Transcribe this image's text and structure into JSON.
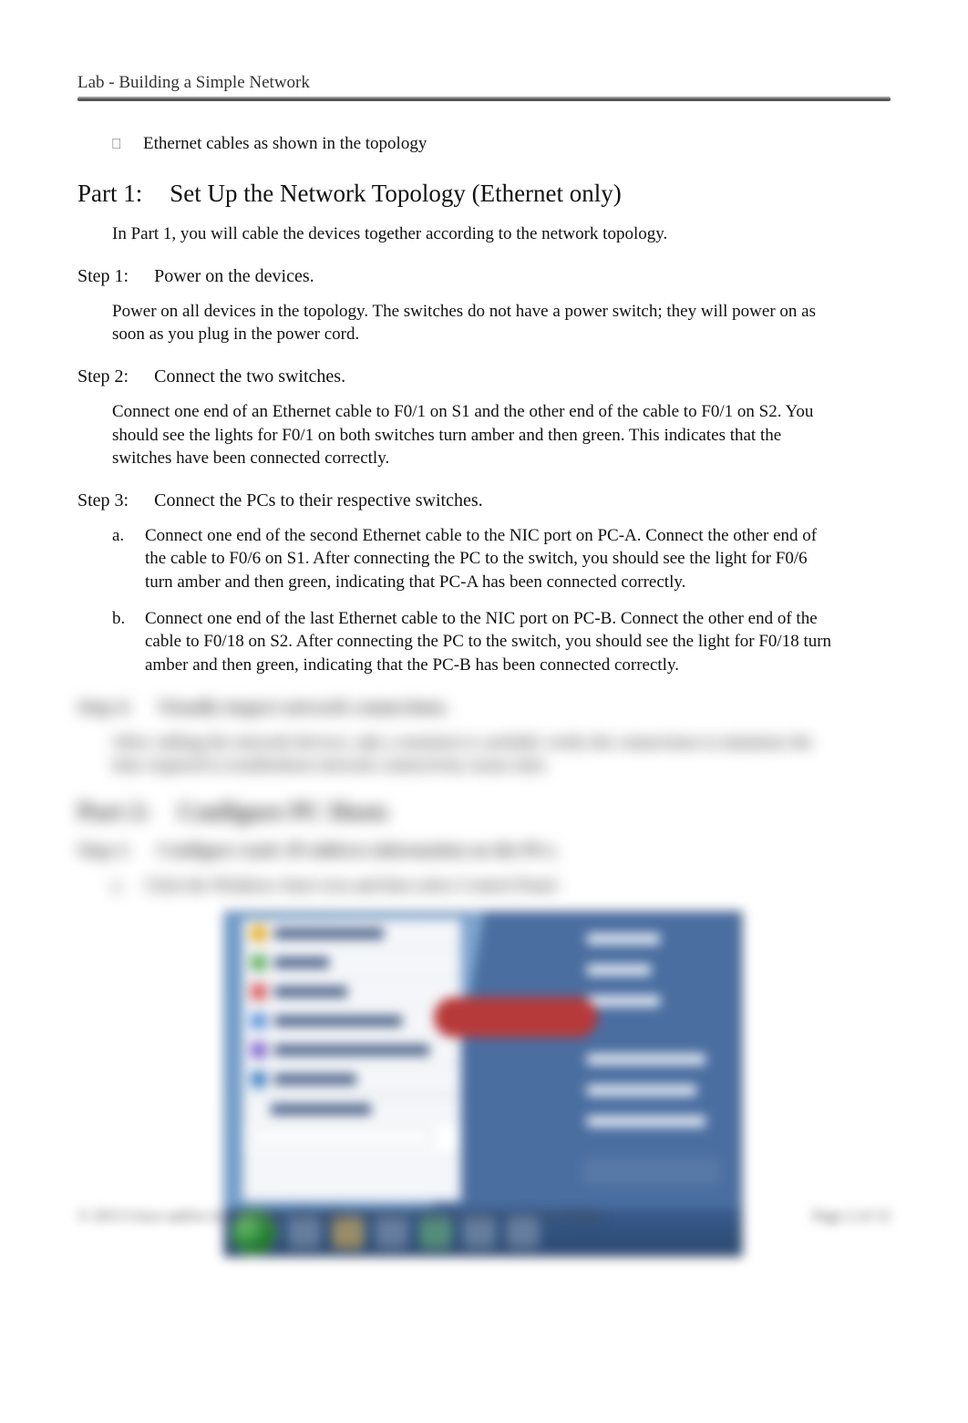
{
  "header": {
    "title": "Lab - Building a Simple Network"
  },
  "bullet": {
    "text": "Ethernet cables as shown in the topology"
  },
  "part1": {
    "label": "Part 1:",
    "title": "Set Up the Network Topology (Ethernet only)",
    "intro": "In Part 1, you will cable the devices together according to the network topology."
  },
  "step1": {
    "label": "Step 1:",
    "title": "Power on the devices.",
    "body": "Power on all devices in the topology. The switches do not have a power switch; they will power on as soon as you plug in the power cord."
  },
  "step2": {
    "label": "Step 2:",
    "title": "Connect the two switches.",
    "body": "Connect one end of an Ethernet cable to F0/1 on S1 and the other end of the cable to F0/1 on S2. You should see the lights for F0/1 on both switches turn amber and then green. This indicates that the switches have been connected correctly."
  },
  "step3": {
    "label": "Step 3:",
    "title": "Connect the PCs to their respective switches.",
    "a_letter": "a.",
    "a_text": "Connect one end of the second Ethernet cable to the NIC port on PC-A. Connect the other end of the cable to F0/6 on S1. After connecting the PC to the switch, you should see the light for F0/6 turn amber and then green, indicating that PC-A has been connected correctly.",
    "b_letter": "b.",
    "b_text": "Connect one end of the last Ethernet cable to the NIC port on PC-B. Connect the other end of the cable to F0/18 on S2. After connecting the PC to the switch, you should see the light for F0/18 turn amber and then green, indicating that the PC-B has been connected correctly."
  },
  "step4": {
    "label": "Step 4:",
    "title": "Visually inspect network connections.",
    "body": "After cabling the network devices, take a moment to carefully verify the connections to minimize the time required to troubleshoot network connectivity issues later."
  },
  "part2": {
    "label": "Part 2:",
    "title": "Configure PC Hosts"
  },
  "p2_step1": {
    "label": "Step 1:",
    "title": "Configure static IP address information on the PCs.",
    "a_letter": "a.",
    "a_text": "Click the Windows Start icon and then select Control Panel."
  },
  "screenshot": {
    "menu_items": [
      "Pictures",
      "Music",
      "Games",
      "Computer",
      "Control Panel",
      "Devices and Printers",
      "Default Programs",
      "Help and Support"
    ],
    "all_programs": "All Programs",
    "highlight": "Control Panel"
  },
  "footer": {
    "left": "© 2013 Cisco and/or its affiliates. All rights reserved. This document is Cisco Public.",
    "right": "Page 2 of 12"
  }
}
